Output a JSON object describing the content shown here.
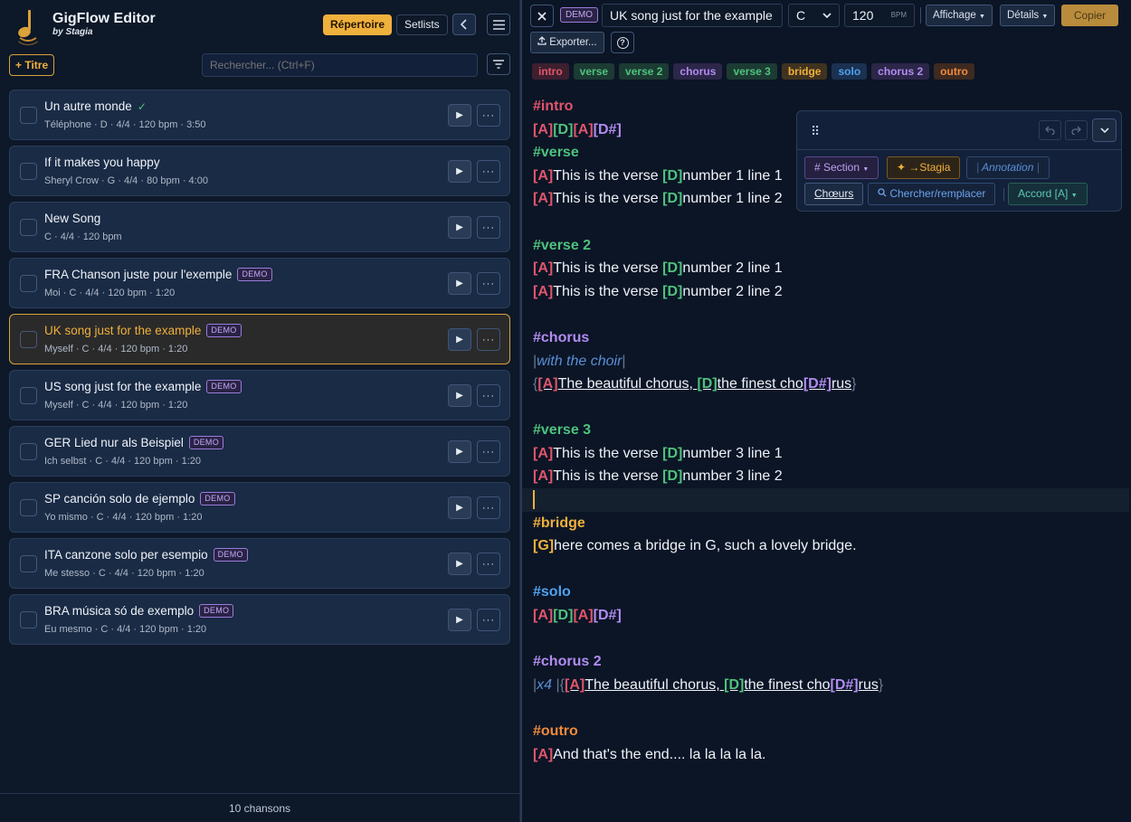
{
  "app": {
    "title": "GigFlow Editor",
    "subtitle": "by Stagia"
  },
  "header": {
    "repertoire": "Répertoire",
    "setlists": "Setlists",
    "collapse_icon": "chevron-left",
    "menu_icon": "hamburger"
  },
  "toolbar": {
    "add_title": "+ Titre",
    "search_placeholder": "Rechercher... (Ctrl+F)"
  },
  "songs": [
    {
      "title": "Un autre monde",
      "meta": "Téléphone · D · 4/4 · 120 bpm · 3:50",
      "demo": false,
      "done": true
    },
    {
      "title": "If it makes you happy",
      "meta": "Sheryl Crow · G · 4/4 · 80 bpm · 4:00",
      "demo": false
    },
    {
      "title": "New Song",
      "meta": "C · 4/4 · 120 bpm",
      "demo": false
    },
    {
      "title": "FRA Chanson juste pour l'exemple",
      "meta": "Moi · C · 4/4 · 120 bpm · 1:20",
      "demo": true
    },
    {
      "title": "UK song just for the example",
      "meta": "Myself · C · 4/4 · 120 bpm · 1:20",
      "demo": true,
      "active": true
    },
    {
      "title": "US song just for the example",
      "meta": "Myself · C · 4/4 · 120 bpm · 1:20",
      "demo": true
    },
    {
      "title": "GER Lied nur als Beispiel",
      "meta": "Ich selbst · C · 4/4 · 120 bpm · 1:20",
      "demo": true
    },
    {
      "title": "SP canción solo de ejemplo",
      "meta": "Yo mismo · C · 4/4 · 120 bpm · 1:20",
      "demo": true
    },
    {
      "title": "ITA canzone solo per esempio",
      "meta": "Me stesso · C · 4/4 · 120 bpm · 1:20",
      "demo": true
    },
    {
      "title": "BRA música só de exemplo",
      "meta": "Eu mesmo · C · 4/4 · 120 bpm · 1:20",
      "demo": true
    }
  ],
  "demo_label": "DEMO",
  "footer": {
    "count": "10 chansons"
  },
  "editor": {
    "demo_label": "DEMO",
    "title": "UK song just for the example",
    "key": "C",
    "bpm": "120",
    "bpm_unit": "BPM",
    "affichage": "Affichage",
    "details": "Détails",
    "copier": "Copier",
    "exporter": "Exporter...",
    "help": "?"
  },
  "section_tags": [
    {
      "label": "intro",
      "color": "#e0556b",
      "bg": "#3d1f2e"
    },
    {
      "label": "verse",
      "color": "#4ec27c",
      "bg": "#1c3b33"
    },
    {
      "label": "verse 2",
      "color": "#4ec27c",
      "bg": "#1c3b33"
    },
    {
      "label": "chorus",
      "color": "#b28cf0",
      "bg": "#2c2649"
    },
    {
      "label": "verse 3",
      "color": "#4ec27c",
      "bg": "#1c3b33"
    },
    {
      "label": "bridge",
      "color": "#f0b03c",
      "bg": "#3f3320"
    },
    {
      "label": "solo",
      "color": "#4ea2f0",
      "bg": "#1b3150"
    },
    {
      "label": "chorus 2",
      "color": "#b28cf0",
      "bg": "#2c2649"
    },
    {
      "label": "outro",
      "color": "#f08a3c",
      "bg": "#3d2a21"
    }
  ],
  "colors": {
    "A": "#e0556b",
    "D": "#4ec27c",
    "D#": "#b28cf0",
    "G": "#f0b03c",
    "accent": "#f0b03c"
  },
  "lines": {
    "l0": "#intro",
    "l2": "#verse",
    "l3": "This is the verse ",
    "l3b": "number 1 line 1",
    "l4": "This is the verse ",
    "l4b": "number 1 line 2",
    "l6": "#verse 2",
    "l7": "This is the verse ",
    "l7b": "number 2 line 1",
    "l8": "This is the verse ",
    "l8b": "number 2 line 2",
    "l10": "#chorus",
    "l11": "with the choir",
    "l12a": "The beautiful chorus, ",
    "l12b": "the finest cho",
    "l12c": "rus",
    "l14": "#verse 3",
    "l15": "This is the verse ",
    "l15b": "number 3 line 1",
    "l16": "This is the verse ",
    "l16b": "number 3 line 2",
    "l18": "#bridge",
    "l19": "here comes a bridge in G, such a lovely bridge.",
    "l21": "#solo",
    "l23": "#chorus 2",
    "l24x": "x4",
    "l24a": "The beautiful chorus, ",
    "l24b": "the finest cho",
    "l24c": "rus",
    "l26": "#outro",
    "l27": "And that's the end.... la la la la la."
  },
  "chords": {
    "A": "[A]",
    "D": "[D]",
    "Ds": "[D#]",
    "G": "[G]"
  },
  "float_toolbar": {
    "section": "# Section",
    "stagia": "✦ →Stagia",
    "annotation": "Annotation",
    "choeurs": "Chœurs",
    "search_replace": "Chercher/remplacer",
    "accord": "Accord [A]"
  }
}
